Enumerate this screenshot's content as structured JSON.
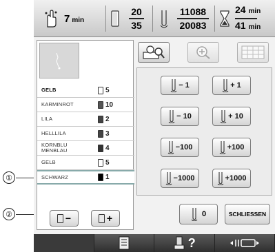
{
  "topbar": {
    "time_value": "7",
    "time_unit": "min",
    "bobbin_current": "20",
    "bobbin_total": "35",
    "stitch_current": "11088",
    "stitch_total": "20083",
    "remaining_time": "24",
    "total_time": "41",
    "remaining_unit": "min",
    "total_unit": "min"
  },
  "colors": [
    {
      "name": "GELB",
      "count": "5",
      "spool": "#ffffff",
      "bold": true
    },
    {
      "name": "KARMINROT",
      "count": "10",
      "spool": "#555555",
      "bold": false
    },
    {
      "name": "LILA",
      "count": "2",
      "spool": "#444444",
      "bold": false
    },
    {
      "name": "HELLLILA",
      "count": "3",
      "spool": "#444444",
      "bold": false
    },
    {
      "name": "KORNBLU MENBLAU",
      "count": "4",
      "spool": "#333333",
      "bold": false
    },
    {
      "name": "GELB",
      "count": "5",
      "spool": "#ffffff",
      "bold": false
    },
    {
      "name": "SCHWARZ",
      "count": "1",
      "spool": "#000000",
      "bold": false
    }
  ],
  "left_buttons": {
    "minus": "−",
    "plus": "+"
  },
  "move_buttons": [
    {
      "label": "− 1"
    },
    {
      "label": "+ 1"
    },
    {
      "label": "− 10"
    },
    {
      "label": "+ 10"
    },
    {
      "label": "−100"
    },
    {
      "label": "+100"
    },
    {
      "label": "−1000"
    },
    {
      "label": "+1000"
    }
  ],
  "zero_label": "0",
  "close_label": "SCHLIESSEN",
  "bottom": {
    "help": "?"
  },
  "callouts": [
    "①",
    "②"
  ],
  "accent": "#7a7a7a"
}
